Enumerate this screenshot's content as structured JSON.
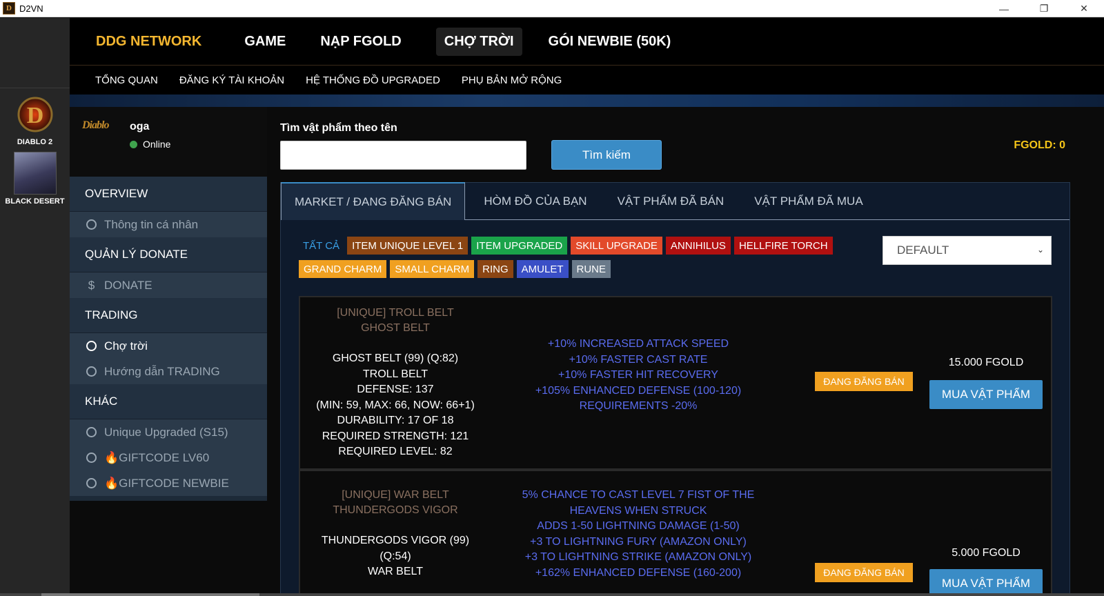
{
  "window": {
    "title": "D2VN",
    "icon_letter": "D"
  },
  "rail": {
    "items": [
      {
        "label": "DIABLO 2",
        "icon": "diablo2-logo"
      },
      {
        "label": "BLACK DESERT",
        "icon": "black-desert-thumbnail"
      }
    ]
  },
  "nav": {
    "brand": "DDG NETWORK",
    "items": [
      "GAME",
      "NẠP FGOLD",
      "CHỢ TRỜI",
      "GÓI NEWBIE (50K)"
    ],
    "active": "CHỢ TRỜI",
    "sub": [
      "TỔNG QUAN",
      "ĐĂNG KÝ TÀI KHOẢN",
      "HỆ THỐNG ĐỒ UPGRADED",
      "PHỤ BẢN MỞ RỘNG"
    ]
  },
  "profile": {
    "logo_text": "Diablo",
    "username": "oga",
    "status": "Online"
  },
  "sidebar": {
    "sections": [
      {
        "title": "OVERVIEW",
        "items": [
          {
            "label": "Thông tin cá nhân",
            "icon": "circle-icon"
          }
        ]
      },
      {
        "title": "QUẢN LÝ DONATE",
        "items": [
          {
            "label": "DONATE",
            "icon": "dollar-icon"
          }
        ]
      },
      {
        "title": "TRADING",
        "items": [
          {
            "label": "Chợ trời",
            "icon": "circle-icon",
            "active": true
          },
          {
            "label": "Hướng dẫn TRADING",
            "icon": "circle-icon"
          }
        ]
      },
      {
        "title": "KHÁC",
        "items": [
          {
            "label": "Unique Upgraded (S15)",
            "icon": "circle-icon"
          },
          {
            "label": "🔥GIFTCODE LV60",
            "icon": "circle-icon"
          },
          {
            "label": "🔥GIFTCODE NEWBIE",
            "icon": "circle-icon"
          }
        ]
      }
    ]
  },
  "search": {
    "label": "Tìm vật phẩm theo tên",
    "value": "",
    "button": "Tìm kiếm"
  },
  "fgold": "FGOLD: 0",
  "tabs": [
    "MARKET / ĐANG ĐĂNG BÁN",
    "HÒM ĐỒ CỦA BẠN",
    "VẬT PHẨM ĐÃ BÁN",
    "VẬT PHẨM ĐÃ MUA"
  ],
  "filters": {
    "all": "TẤT CẢ",
    "row1": [
      {
        "label": "ITEM UNIQUE LEVEL 1",
        "color": "#8b4513"
      },
      {
        "label": "ITEM UPGRADED",
        "color": "#1aa34a"
      },
      {
        "label": "SKILL UPGRADE",
        "color": "#e24a2a"
      },
      {
        "label": "ANNIHILUS",
        "color": "#b01010"
      },
      {
        "label": "HELLFIRE TORCH",
        "color": "#b01010"
      }
    ],
    "row2": [
      {
        "label": "GRAND CHARM",
        "color": "#f0a020"
      },
      {
        "label": "SMALL CHARM",
        "color": "#f0a020"
      },
      {
        "label": "RING",
        "color": "#8b4513"
      },
      {
        "label": "AMULET",
        "color": "#3a4fc6"
      },
      {
        "label": "RUNE",
        "color": "#6a7a8a"
      }
    ]
  },
  "sort": {
    "selected": "DEFAULT"
  },
  "listings": [
    {
      "title": "[UNIQUE] TROLL BELT",
      "subtitle": "GHOST BELT",
      "props": [
        "GHOST BELT (99) (Q:82)",
        "TROLL BELT",
        "DEFENSE: 137",
        "(MIN: 59, MAX: 66, NOW: 66+1)",
        "DURABILITY: 17 OF 18",
        "REQUIRED STRENGTH: 121",
        "REQUIRED LEVEL: 82"
      ],
      "mods": [
        "+10% INCREASED ATTACK SPEED",
        "+10% FASTER CAST RATE",
        "+10% FASTER HIT RECOVERY",
        "+105% ENHANCED DEFENSE (100-120)",
        "REQUIREMENTS -20%"
      ],
      "status": "ĐANG ĐĂNG BÁN",
      "price": "15.000 FGOLD",
      "buy": "MUA VẬT PHẨM"
    },
    {
      "title": "[UNIQUE] WAR BELT",
      "subtitle": "THUNDERGODS VIGOR",
      "props": [
        "THUNDERGODS VIGOR (99)",
        "(Q:54)",
        "WAR BELT"
      ],
      "mods": [
        "5% CHANCE TO CAST LEVEL 7 FIST OF THE",
        "HEAVENS WHEN STRUCK",
        "ADDS 1-50 LIGHTNING DAMAGE (1-50)",
        "+3 TO LIGHTNING FURY (AMAZON ONLY)",
        "+3 TO LIGHTNING STRIKE (AMAZON ONLY)",
        "+162% ENHANCED DEFENSE (160-200)"
      ],
      "status": "ĐANG ĐĂNG BÁN",
      "price": "5.000 FGOLD",
      "buy": "MUA VẬT PHẨM"
    }
  ]
}
